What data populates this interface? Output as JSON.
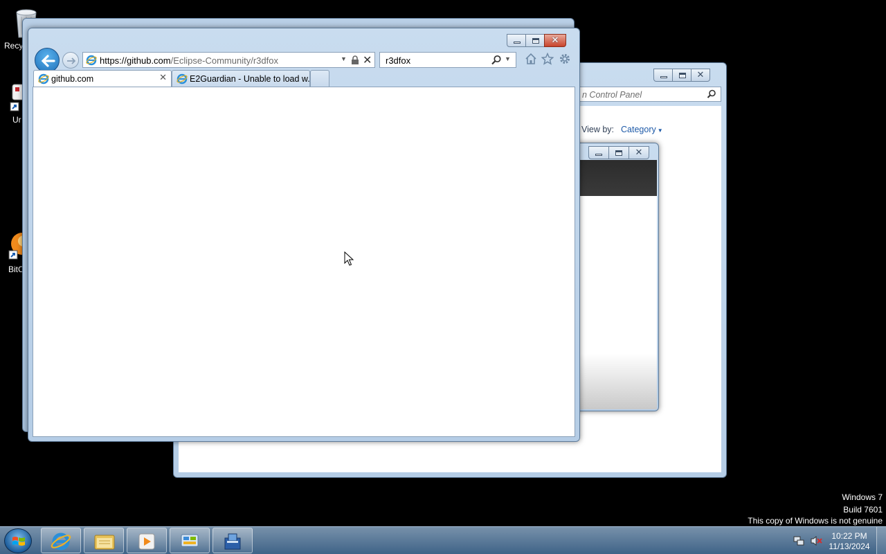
{
  "desktop": {
    "icons": [
      {
        "label": "Recy"
      },
      {
        "label": "Ur"
      },
      {
        "label": "BitC"
      }
    ]
  },
  "ie": {
    "url_host": "https://github.com",
    "url_path": "/Eclipse-Community/r3dfox",
    "search_value": "r3dfox",
    "tabs": [
      {
        "title": "github.com",
        "active": true
      },
      {
        "title": "E2Guardian - Unable to load w...",
        "active": false
      }
    ]
  },
  "control_panel": {
    "search_placeholder": "n Control Panel",
    "view_by_label": "View by:",
    "view_by_value": "Category"
  },
  "watermark": {
    "line1": "Windows 7",
    "line2": "Build 7601",
    "line3": "This copy of Windows is not genuine"
  },
  "taskbar": {
    "items": [
      "internet-explorer",
      "windows-explorer",
      "media-player",
      "control-panel",
      "app-installer"
    ],
    "time": "10:22 PM",
    "date": "11/13/2024"
  },
  "colors": {
    "desktop": "#000000",
    "aero_frame": "#b9cfe6",
    "link_blue": "#1e5aa8"
  }
}
